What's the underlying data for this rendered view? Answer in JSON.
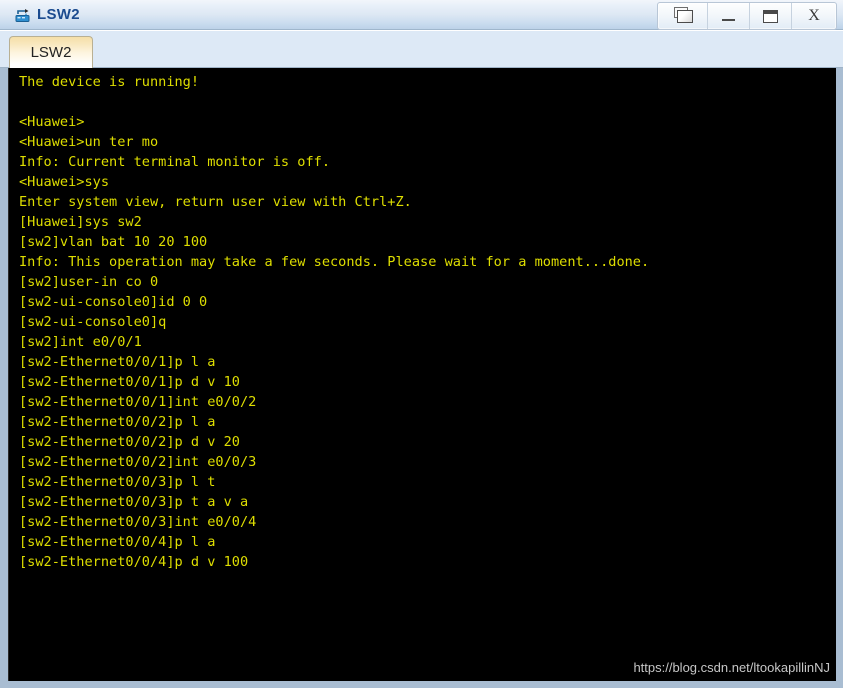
{
  "window": {
    "title": "LSW2",
    "icon": "switch-device-icon",
    "controls": [
      {
        "name": "restore-windows-button",
        "icon": "cascade-windows-icon",
        "label": ""
      },
      {
        "name": "minimize-button",
        "icon": "minimize-icon",
        "label": ""
      },
      {
        "name": "maximize-button",
        "icon": "maximize-icon",
        "label": ""
      },
      {
        "name": "close-button",
        "icon": "close-icon",
        "label": "X"
      }
    ]
  },
  "tabs": [
    {
      "label": "LSW2",
      "active": true
    }
  ],
  "terminal": {
    "text_color": "#dede00",
    "background_color": "#000000",
    "lines": [
      "The device is running!",
      "",
      "<Huawei>",
      "<Huawei>un ter mo",
      "Info: Current terminal monitor is off.",
      "<Huawei>sys",
      "Enter system view, return user view with Ctrl+Z.",
      "[Huawei]sys sw2",
      "[sw2]vlan bat 10 20 100",
      "Info: This operation may take a few seconds. Please wait for a moment...done.",
      "[sw2]user-in co 0",
      "[sw2-ui-console0]id 0 0",
      "[sw2-ui-console0]q",
      "[sw2]int e0/0/1",
      "[sw2-Ethernet0/0/1]p l a",
      "[sw2-Ethernet0/0/1]p d v 10",
      "[sw2-Ethernet0/0/1]int e0/0/2",
      "[sw2-Ethernet0/0/2]p l a",
      "[sw2-Ethernet0/0/2]p d v 20",
      "[sw2-Ethernet0/0/2]int e0/0/3",
      "[sw2-Ethernet0/0/3]p l t",
      "[sw2-Ethernet0/0/3]p t a v a",
      "[sw2-Ethernet0/0/3]int e0/0/4",
      "[sw2-Ethernet0/0/4]p l a",
      "[sw2-Ethernet0/0/4]p d v 100"
    ]
  },
  "watermark": {
    "text": "https://blog.csdn.net/ltookapillinNJ"
  }
}
